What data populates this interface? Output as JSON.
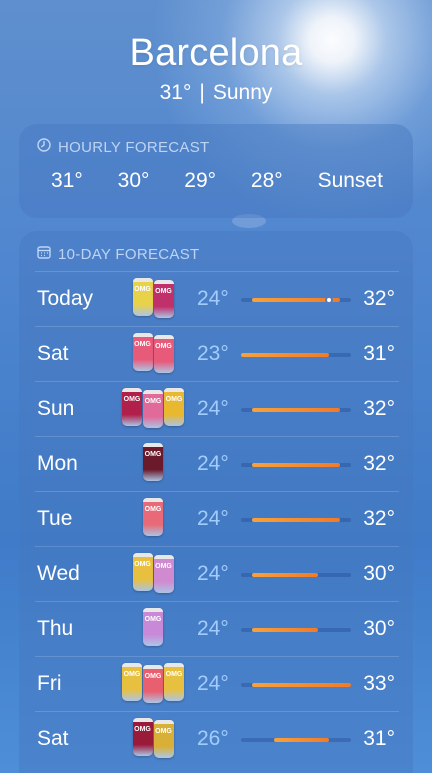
{
  "header": {
    "city": "Barcelona",
    "temperature": "31°",
    "separator": "|",
    "condition": "Sunny"
  },
  "hourly": {
    "title": "HOURLY FORECAST",
    "icon": "clock-icon",
    "items": [
      "31°",
      "30°",
      "29°",
      "28°",
      "Sunset"
    ]
  },
  "daily": {
    "title": "10-DAY FORECAST",
    "icon": "calendar-icon",
    "range_min": 23,
    "range_max": 33,
    "days": [
      {
        "name": "Today",
        "low": "24°",
        "high": "32°",
        "low_val": 24,
        "high_val": 32,
        "current_val": 31,
        "cans": [
          "#e8d24a",
          "#c0306a"
        ]
      },
      {
        "name": "Sat",
        "low": "23°",
        "high": "31°",
        "low_val": 23,
        "high_val": 31,
        "cans": [
          "#e85a7a",
          "#e85a7a"
        ]
      },
      {
        "name": "Sun",
        "low": "24°",
        "high": "32°",
        "low_val": 24,
        "high_val": 32,
        "cans": [
          "#b0204a",
          "#e06a9a",
          "#e8b830"
        ]
      },
      {
        "name": "Mon",
        "low": "24°",
        "high": "32°",
        "low_val": 24,
        "high_val": 32,
        "cans": [
          "#6a1a2a"
        ]
      },
      {
        "name": "Tue",
        "low": "24°",
        "high": "32°",
        "low_val": 24,
        "high_val": 32,
        "cans": [
          "#e86a78"
        ]
      },
      {
        "name": "Wed",
        "low": "24°",
        "high": "30°",
        "low_val": 24,
        "high_val": 30,
        "cans": [
          "#e8c040",
          "#d08ad0"
        ]
      },
      {
        "name": "Thu",
        "low": "24°",
        "high": "30°",
        "low_val": 24,
        "high_val": 30,
        "cans": [
          "#c88ad8"
        ]
      },
      {
        "name": "Fri",
        "low": "24°",
        "high": "33°",
        "low_val": 24,
        "high_val": 33,
        "cans": [
          "#e8c040",
          "#e86070",
          "#e8c040"
        ]
      },
      {
        "name": "Sat",
        "low": "26°",
        "high": "31°",
        "low_val": 26,
        "high_val": 31,
        "cans": [
          "#9a1a3a",
          "#d8b038"
        ]
      }
    ]
  }
}
